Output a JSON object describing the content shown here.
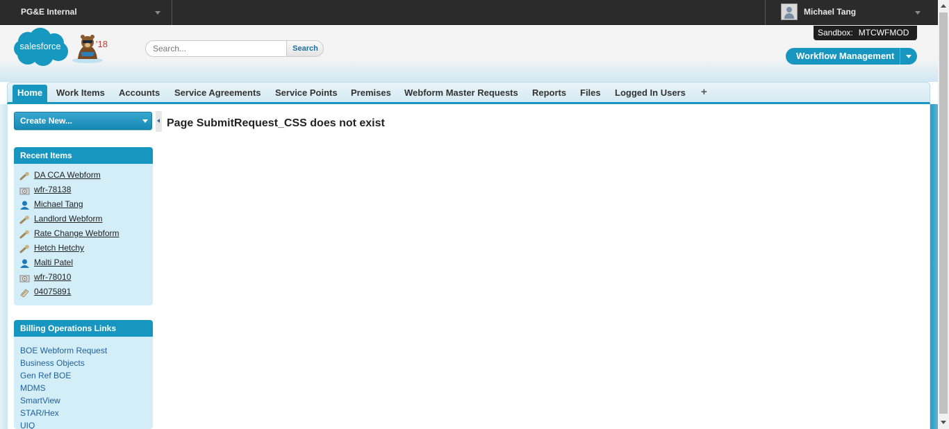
{
  "topbar": {
    "org_name": "PG&E Internal",
    "user_name": "Michael Tang"
  },
  "sandbox": {
    "label": "Sandbox:",
    "value": "MTCWFMOD"
  },
  "header": {
    "logo_text": "salesforce",
    "mascot_badge": "'18",
    "search_placeholder": "Search...",
    "search_button": "Search",
    "app_menu_label": "Workflow Management"
  },
  "tabs": [
    {
      "label": "Home",
      "active": true
    },
    {
      "label": "Work Items"
    },
    {
      "label": "Accounts"
    },
    {
      "label": "Service Agreements"
    },
    {
      "label": "Service Points"
    },
    {
      "label": "Premises"
    },
    {
      "label": "Webform Master Requests"
    },
    {
      "label": "Reports"
    },
    {
      "label": "Files"
    },
    {
      "label": "Logged In Users"
    }
  ],
  "tab_plus": "+",
  "sidebar": {
    "create_new_label": "Create New...",
    "recent_items_title": "Recent Items",
    "recent_items": [
      {
        "label": "DA CCA Webform",
        "icon": "wrench-icon"
      },
      {
        "label": "wfr-78138",
        "icon": "gears-icon"
      },
      {
        "label": "Michael Tang",
        "icon": "user-icon"
      },
      {
        "label": "Landlord Webform",
        "icon": "wrench-icon"
      },
      {
        "label": "Rate Change Webform",
        "icon": "wrench-icon"
      },
      {
        "label": "Hetch Hetchy",
        "icon": "wrench-icon"
      },
      {
        "label": "Malti Patel",
        "icon": "user-icon"
      },
      {
        "label": "wfr-78010",
        "icon": "gears-icon"
      },
      {
        "label": "04075891",
        "icon": "case-icon"
      }
    ],
    "billing_links_title": "Billing Operations Links",
    "billing_links": [
      "BOE Webform Request",
      "Business Objects",
      "Gen Ref BOE",
      "MDMS",
      "SmartView",
      "STAR/Hex",
      "UIQ"
    ]
  },
  "main": {
    "message": "Page SubmitRequest_CSS does not exist"
  },
  "colors": {
    "accent": "#1797c0",
    "topbar": "#2b2b2b",
    "panel_bg": "#d3eef7"
  }
}
